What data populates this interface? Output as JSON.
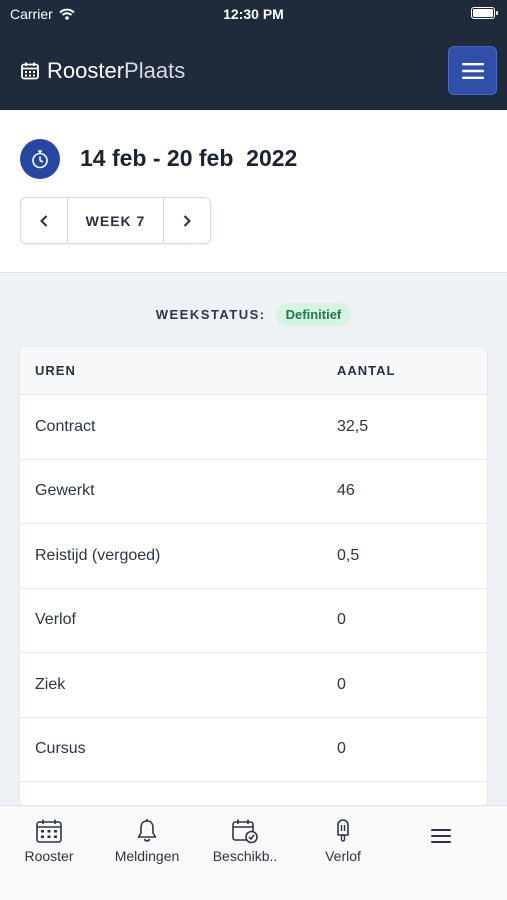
{
  "status_bar": {
    "carrier": "Carrier",
    "time": "12:30 PM"
  },
  "app": {
    "brand_part1": "Rooster",
    "brand_part2": "Plaats"
  },
  "week": {
    "date_range": "14 feb - 20 feb",
    "year": "2022",
    "week_label": "WEEK 7"
  },
  "week_status": {
    "label": "WEEKSTATUS:",
    "value": "Definitief"
  },
  "table": {
    "headers": [
      "UREN",
      "AANTAL"
    ],
    "rows": [
      {
        "label": "Contract",
        "value": "32,5"
      },
      {
        "label": "Gewerkt",
        "value": "46"
      },
      {
        "label": "Reistijd (vergoed)",
        "value": "0,5"
      },
      {
        "label": "Verlof",
        "value": "0"
      },
      {
        "label": "Ziek",
        "value": "0"
      },
      {
        "label": "Cursus",
        "value": "0"
      }
    ]
  },
  "tabs": [
    {
      "label": "Rooster",
      "icon": "calendar-icon"
    },
    {
      "label": "Meldingen",
      "icon": "bell-icon"
    },
    {
      "label": "Beschikb..",
      "icon": "calendar-check-icon"
    },
    {
      "label": "Verlof",
      "icon": "popsicle-icon"
    },
    {
      "label": "",
      "icon": "hamburger-icon"
    }
  ],
  "colors": {
    "header_bg": "#1f2a3a",
    "accent": "#2f4fa8",
    "status_badge_bg": "#d6f4e2",
    "status_badge_text": "#1f7a46"
  }
}
